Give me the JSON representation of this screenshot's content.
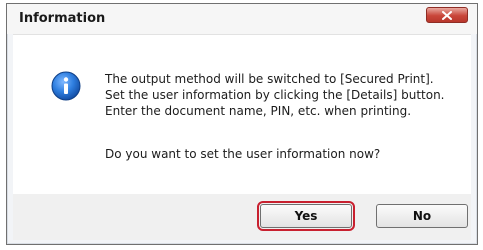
{
  "dialog": {
    "title": "Information",
    "icon": "info-icon",
    "message_lines": [
      "The output method will be switched to [Secured Print].",
      "Set the user information by clicking the [Details] button.",
      "Enter the document name, PIN, etc. when printing."
    ],
    "question": "Do you want to set the user information now?",
    "buttons": {
      "yes_label": "Yes",
      "no_label": "No",
      "default": "Yes"
    }
  },
  "colors": {
    "focus_outline": "#c8202f",
    "close_button": "#c9463a",
    "info_icon_blue": "#1f6fd1"
  }
}
